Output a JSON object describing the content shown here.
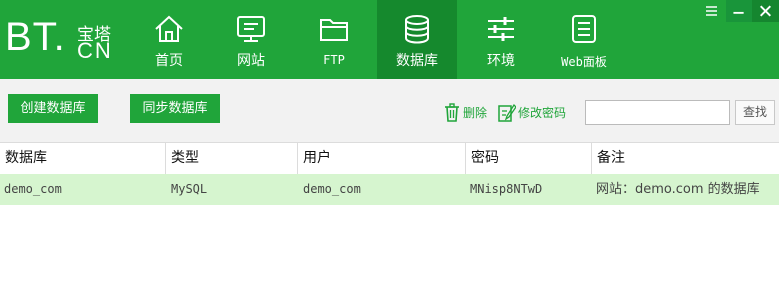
{
  "brand": {
    "bt": "BT.",
    "cn_top": "宝塔",
    "cn_bottom": "CN"
  },
  "nav": [
    {
      "label": "首页",
      "icon": "home-icon"
    },
    {
      "label": "网站",
      "icon": "monitor-icon"
    },
    {
      "label": "FTP",
      "icon": "folder-icon"
    },
    {
      "label": "数据库",
      "icon": "database-icon",
      "active": true
    },
    {
      "label": "环境",
      "icon": "sliders-icon"
    },
    {
      "label": "Web面板",
      "icon": "panel-list-icon"
    }
  ],
  "window": {
    "menu_icon": "menu-icon",
    "minimize_icon": "minimize-icon",
    "close_icon": "close-icon"
  },
  "toolbar": {
    "create_db": "创建数据库",
    "sync_db": "同步数据库",
    "delete": "删除",
    "change_password": "修改密码",
    "search_placeholder": "",
    "search_button": "查找"
  },
  "table": {
    "headers": [
      "数据库",
      "类型",
      "用户",
      "密码",
      "备注"
    ],
    "rows": [
      {
        "database": "demo_com",
        "type": "MySQL",
        "user": "demo_com",
        "password": "MNisp8NTwD",
        "note": "网站：demo.com 的数据库"
      }
    ]
  },
  "colors": {
    "brand_green": "#20a53a",
    "active_tab": "#15892d",
    "selected_row": "#d6f5cf",
    "toolbar_bg": "#f2f2f2"
  }
}
